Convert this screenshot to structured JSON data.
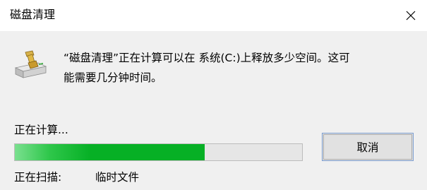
{
  "window": {
    "title": "磁盘清理",
    "close_icon": "close-icon"
  },
  "message": {
    "line1": "“磁盘清理”正在计算可以在 系统(C:)上释放多少空间。这可",
    "line2": "能需要几分钟时间。",
    "icon": "disk-cleanup-icon"
  },
  "progress": {
    "status_text": "正在计算...",
    "value_fraction": 0.66,
    "fill_color": "#06b025",
    "track_color": "#e6e6e6"
  },
  "actions": {
    "cancel_label": "取消"
  },
  "scan": {
    "label": "正在扫描:",
    "item": "临时文件"
  }
}
